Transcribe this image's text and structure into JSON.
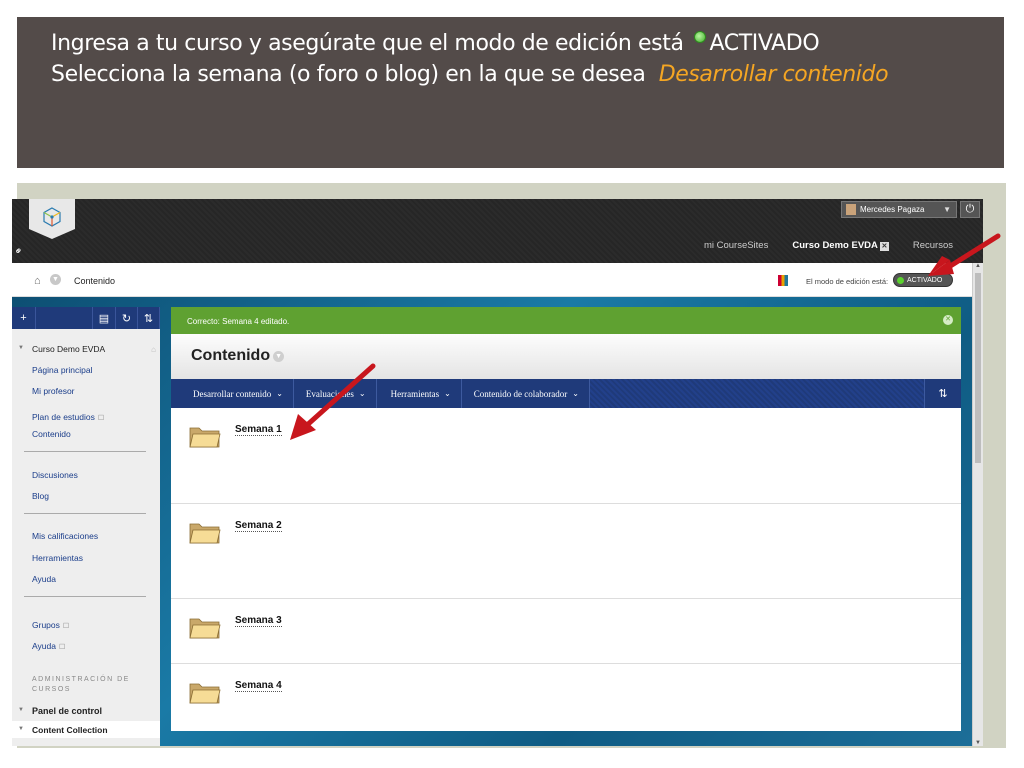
{
  "banner": {
    "line1_text": "Ingresa a tu curso y asegúrate que el modo de edición está",
    "line1_status": "ACTIVADO",
    "line2_text": "Selecciona la semana (o foro o blog) en la que se desea",
    "line2_highlight": "Desarrollar contenido",
    "highlight_color": "#f5a623"
  },
  "header": {
    "user_name": "Mercedes Pagaza",
    "tabs": [
      "mi CourseSites",
      "Curso Demo EVDA",
      "Recursos"
    ],
    "active_tab": "Curso Demo EVDA"
  },
  "breadcrumb": {
    "current": "Contenido",
    "edit_mode_label": "El modo de edición está:",
    "edit_mode_state": "ACTIVADO"
  },
  "sidebar": {
    "course_title": "Curso Demo EVDA",
    "items": [
      "Página principal",
      "Mi profesor",
      "Plan de estudios",
      "Contenido",
      "Discusiones",
      "Blog",
      "Mis calificaciones",
      "Herramientas",
      "Ayuda",
      "Grupos",
      "Ayuda"
    ],
    "admin_heading_1": "ADMINISTRACIÓN DE",
    "admin_heading_2": "CURSOS",
    "control_panel": "Panel de control",
    "content_collection": "Content Collection"
  },
  "main": {
    "success_message": "Correcto: Semana 4 editado.",
    "page_title": "Contenido",
    "menu": [
      "Desarrollar contenido",
      "Evaluaciones",
      "Herramientas",
      "Contenido de colaborador"
    ],
    "items": [
      "Semana 1",
      "Semana 2",
      "Semana 3",
      "Semana 4"
    ]
  },
  "colors": {
    "banner_bg": "#534b49",
    "nav_blue": "#1f3a7a",
    "success_green": "#5fa131",
    "arrow_red": "#c8161d"
  }
}
